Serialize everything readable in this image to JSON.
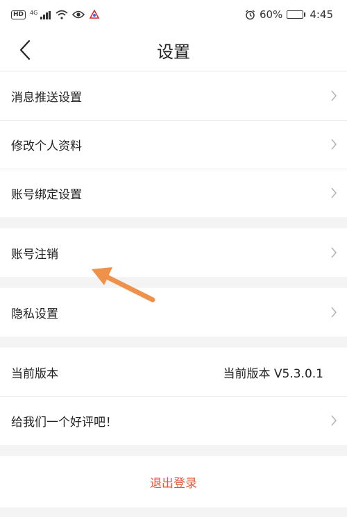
{
  "status_bar": {
    "hd": "HD",
    "network": "4G",
    "battery_percent": "60%",
    "battery_level": 0.6,
    "time": "4:45"
  },
  "header": {
    "title": "设置"
  },
  "groups": {
    "g1": [
      {
        "label": "消息推送设置"
      },
      {
        "label": "修改个人资料"
      },
      {
        "label": "账号绑定设置"
      }
    ],
    "g2": [
      {
        "label": "账号注销"
      }
    ],
    "g3": [
      {
        "label": "隐私设置"
      }
    ],
    "g4": [
      {
        "label": "当前版本",
        "value": "当前版本 V5.3.0.1"
      },
      {
        "label": "给我们一个好评吧！"
      }
    ]
  },
  "logout": {
    "label": "退出登录"
  },
  "colors": {
    "accent": "#e8553c",
    "annotation_arrow": "#f0914a",
    "background": "#f4f4f4"
  },
  "icons": {
    "back": "chevron-left-icon",
    "row_chevron": "chevron-right-icon",
    "alarm": "alarm-icon",
    "wifi": "wifi-icon",
    "signal": "signal-icon",
    "eye": "eye-icon"
  }
}
